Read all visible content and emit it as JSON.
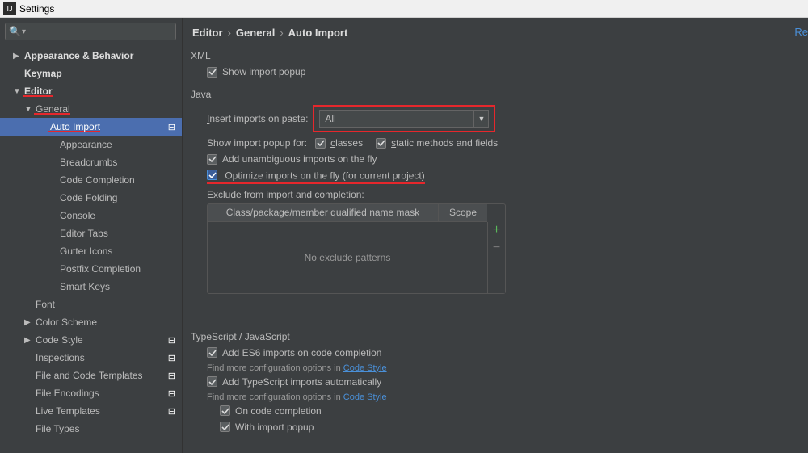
{
  "window": {
    "title": "Settings"
  },
  "sidebar": {
    "items": [
      {
        "label": "Appearance & Behavior",
        "bold": true,
        "arrow": "▶",
        "depth": 1
      },
      {
        "label": "Keymap",
        "bold": true,
        "depth": 1
      },
      {
        "label": "Editor",
        "bold": true,
        "arrow": "▼",
        "depth": 1,
        "redline": true
      },
      {
        "label": "General",
        "bold": false,
        "arrow": "▼",
        "depth": 2,
        "redline": true
      },
      {
        "label": "Auto Import",
        "depth": 3,
        "selected": true,
        "redline": true,
        "hasIcon": true
      },
      {
        "label": "Appearance",
        "depth": 4
      },
      {
        "label": "Breadcrumbs",
        "depth": 4
      },
      {
        "label": "Code Completion",
        "depth": 4
      },
      {
        "label": "Code Folding",
        "depth": 4
      },
      {
        "label": "Console",
        "depth": 4
      },
      {
        "label": "Editor Tabs",
        "depth": 4
      },
      {
        "label": "Gutter Icons",
        "depth": 4
      },
      {
        "label": "Postfix Completion",
        "depth": 4
      },
      {
        "label": "Smart Keys",
        "depth": 4
      },
      {
        "label": "Font",
        "depth": 2
      },
      {
        "label": "Color Scheme",
        "arrow": "▶",
        "depth": 2
      },
      {
        "label": "Code Style",
        "arrow": "▶",
        "depth": 2,
        "hasIcon": true
      },
      {
        "label": "Inspections",
        "depth": 2,
        "hasIcon": true
      },
      {
        "label": "File and Code Templates",
        "depth": 2,
        "hasIcon": true
      },
      {
        "label": "File Encodings",
        "depth": 2,
        "hasIcon": true
      },
      {
        "label": "Live Templates",
        "depth": 2,
        "hasIcon": true
      },
      {
        "label": "File Types",
        "depth": 2
      }
    ]
  },
  "breadcrumb": {
    "p1": "Editor",
    "p2": "General",
    "p3": "Auto Import"
  },
  "topright": "Re",
  "xml": {
    "title": "XML",
    "show_popup": "Show import popup"
  },
  "java": {
    "title": "Java",
    "insert_label": "Insert imports on paste:",
    "select_value": "All",
    "popup_for": "Show import popup for:",
    "classes": "classes",
    "static": "static methods and fields",
    "add_unambig": "Add unambiguous imports on the fly",
    "optimize": "Optimize imports on the fly (for current project)",
    "exclude_label": "Exclude from import and completion:",
    "col1": "Class/package/member qualified name mask",
    "col2": "Scope",
    "empty": "No exclude patterns"
  },
  "ts": {
    "title": "TypeScript / JavaScript",
    "add_es6": "Add ES6 imports on code completion",
    "note1a": "Find more configuration options in ",
    "note1b": "Code Style",
    "add_ts": "Add TypeScript imports automatically",
    "on_completion": "On code completion",
    "with_popup": "With import popup"
  }
}
